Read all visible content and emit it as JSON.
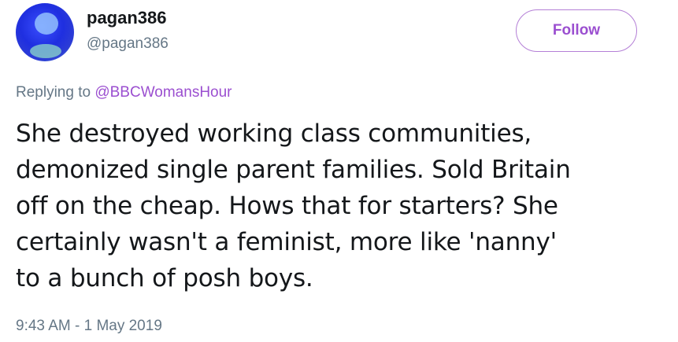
{
  "tweet": {
    "author": {
      "display_name": "pagan386",
      "handle": "@pagan386"
    },
    "follow_label": "Follow",
    "replying": {
      "prefix": "Replying to",
      "mention": "@BBCWomansHour"
    },
    "text_lines": [
      "She destroyed working class communities,",
      "demonized single parent families. Sold Britain",
      "off on the cheap. Hows that for starters? She",
      "certainly wasn't a feminist, more like 'nanny'",
      "to a bunch of posh boys."
    ],
    "timestamp": "9:43 AM - 1 May 2019"
  },
  "colors": {
    "accent": "#9b4fd0",
    "secondary_text": "#657786",
    "primary_text": "#14171a"
  }
}
